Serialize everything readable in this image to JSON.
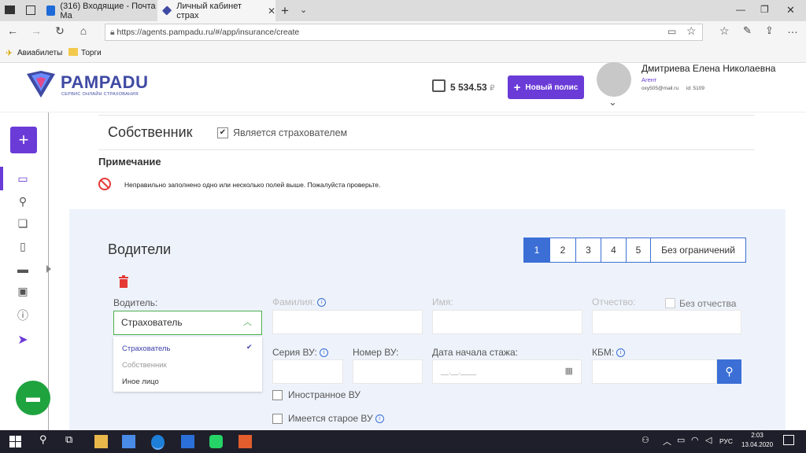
{
  "browser": {
    "tabs": [
      {
        "label": "(316) Входящие - Почта Ma"
      },
      {
        "label": "Личный кабинет страх"
      }
    ],
    "url": "https://agents.pampadu.ru/#/app/insurance/create",
    "favorites": [
      {
        "label": "Авиабилеты"
      },
      {
        "label": "Торги"
      }
    ]
  },
  "header": {
    "logo": "PAMPADU",
    "logo_tagline": "СЕРВИС ОНЛАЙН СТРАХОВАНИЯ",
    "balance": "5 534.53",
    "currency": "₽",
    "new_policy_label": "Новый полис",
    "user_name": "Дмитриева Елена Николаевна",
    "user_role": "Агент",
    "user_email": "oxy505@mail.ru",
    "user_id": "id: 5109"
  },
  "owner": {
    "title": "Собственник",
    "is_insured_label": "Является страхователем",
    "is_insured_checked": true,
    "note_title": "Примечание",
    "note_text": "Неправильно заполнено одно или несколько полей выше. Пожалуйста проверьте."
  },
  "drivers": {
    "title": "Водители",
    "pager": [
      "1",
      "2",
      "3",
      "4",
      "5",
      "Без ограничений"
    ],
    "pager_active": "1",
    "driver_label": "Водитель:",
    "driver_selected": "Страхователь",
    "driver_options": [
      "Страхователь",
      "Собственник",
      "Иное лицо"
    ],
    "lastname_label": "Фамилия:",
    "firstname_label": "Имя:",
    "patronymic_label": "Отчество:",
    "no_patronymic_label": "Без отчества",
    "license_series_label": "Серия ВУ:",
    "license_number_label": "Номер ВУ:",
    "experience_start_label": "Дата начала стажа:",
    "experience_start_placeholder": "__.__.____",
    "kbm_label": "КБМ:",
    "foreign_license_label": "Иностранное ВУ",
    "old_license_label": "Имеется старое ВУ"
  },
  "taskbar": {
    "lang": "РУС",
    "time": "2:03",
    "date": "13.04.2020"
  },
  "colors": {
    "brand": "#6a3bd7",
    "primary": "#3b6fd6",
    "success": "#4caf50",
    "panel_bg": "#eef3fb"
  }
}
